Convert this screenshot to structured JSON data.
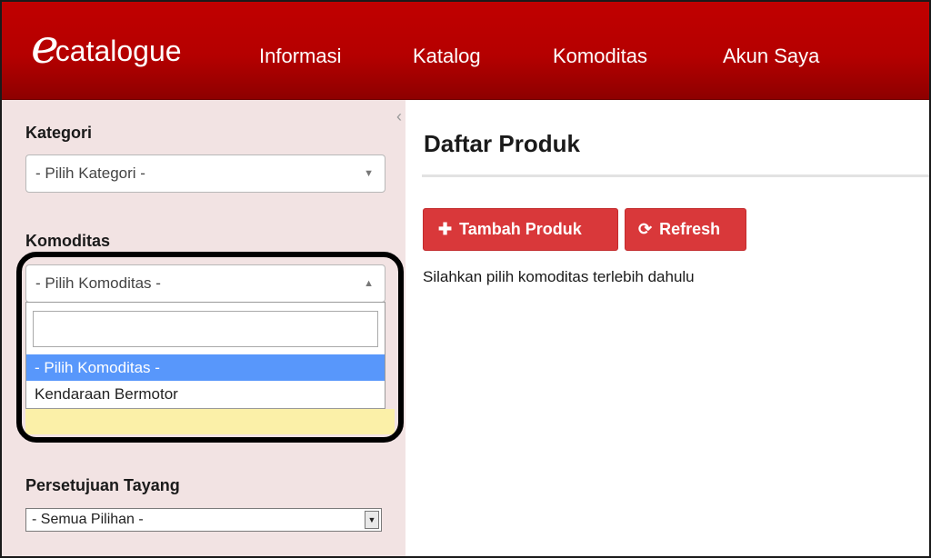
{
  "navbar": {
    "brand_letter": "e",
    "brand_text": "catalogue",
    "items": [
      {
        "label": "Informasi"
      },
      {
        "label": "Katalog"
      },
      {
        "label": "Komoditas"
      },
      {
        "label": "Akun Saya"
      }
    ]
  },
  "sidebar": {
    "collapse_icon": "chevron-left-icon",
    "kategori": {
      "label": "Kategori",
      "selected": "- Pilih Kategori -"
    },
    "komoditas": {
      "label": "Komoditas",
      "selected": "- Pilih Komoditas -",
      "search_value": "",
      "options": [
        {
          "label": "- Pilih Komoditas -"
        },
        {
          "label": "Kendaraan Bermotor"
        }
      ]
    },
    "persetujuan": {
      "label": "Persetujuan Tayang",
      "selected": "- Semua Pilihan -"
    }
  },
  "main": {
    "title": "Daftar Produk",
    "add_button": {
      "icon": "plus-icon",
      "label": "Tambah Produk"
    },
    "refresh_button": {
      "icon": "refresh-icon",
      "label": "Refresh"
    },
    "message": "Silahkan pilih komoditas terlebih dahulu"
  },
  "colors": {
    "navbar": "#c00000",
    "sidebar_bg": "#f2e3e3",
    "button": "#d9383a",
    "option_highlight": "#5897fb",
    "notice_bg": "#fbf0a8"
  }
}
